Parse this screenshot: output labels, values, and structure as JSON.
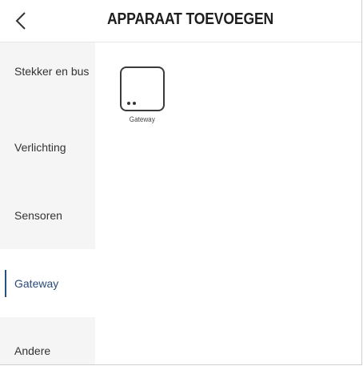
{
  "header": {
    "title": "APPARAAT TOEVOEGEN",
    "back_icon": "chevron-left-icon"
  },
  "sidebar": {
    "items": [
      {
        "label": "Stekker en bus",
        "active": false
      },
      {
        "label": "Verlichting",
        "active": false
      },
      {
        "label": "Sensoren",
        "active": false
      },
      {
        "label": "Gateway",
        "active": true
      },
      {
        "label": "Andere",
        "active": false
      }
    ],
    "active_color": "#2b4f80"
  },
  "content": {
    "devices": [
      {
        "label": "Gateway",
        "icon": "gateway-device-icon"
      }
    ]
  }
}
